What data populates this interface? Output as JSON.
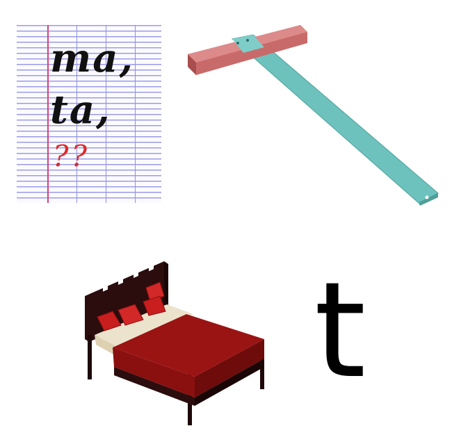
{
  "notebook": {
    "line1": "ma,",
    "line2": "ta,",
    "line3": "??"
  },
  "pictures": {
    "top_right": "t-square-ruler",
    "bottom_left": "bed"
  },
  "letter": "t",
  "colors": {
    "notebook_lines": "#9b9be8",
    "notebook_margin": "#d2447a",
    "question_marks": "#dc2a2a",
    "ruler_head": "#c96a6a",
    "ruler_blade": "#6ec2bd",
    "bed_frame": "#2b0d0d",
    "bed_cover": "#9b1414",
    "bed_sheet": "#ece3cc"
  }
}
